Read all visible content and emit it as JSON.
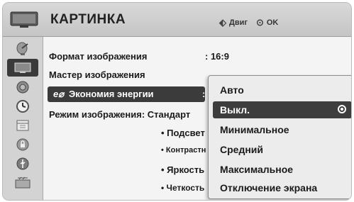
{
  "header": {
    "title": "КАРТИНКА",
    "nav_symbol": "⬖",
    "nav_label": "Двиг",
    "ok_symbol": "⊙",
    "ok_label": "OK"
  },
  "sidebar": {
    "items": [
      {
        "icon": "satellite-dish-icon"
      },
      {
        "icon": "tv-picture-icon",
        "selected": true
      },
      {
        "icon": "speaker-icon"
      },
      {
        "icon": "clock-icon"
      },
      {
        "icon": "calendar-icon"
      },
      {
        "icon": "lock-icon"
      },
      {
        "icon": "usb-icon"
      },
      {
        "icon": "dvr-icon"
      }
    ]
  },
  "menu": {
    "aspect_label": "Формат изображения",
    "aspect_value": ": 16:9",
    "wizard_label": "Мастер изображения",
    "energy_label": "Экономия энергии",
    "energy_colon": ":",
    "mode_label": "Режим изображения: Стандарт",
    "sub_items": [
      "• Подсвет",
      "• Контрастн",
      "• Яркость",
      "• Четкость"
    ]
  },
  "popup": {
    "options": [
      {
        "label": "Авто",
        "selected": false
      },
      {
        "label": "Выкл.",
        "selected": true
      },
      {
        "label": "Минимальное",
        "selected": false
      },
      {
        "label": "Средний",
        "selected": false
      },
      {
        "label": "Максимальное",
        "selected": false
      },
      {
        "label": "Отключение экрана",
        "selected": false
      }
    ]
  },
  "colors": {
    "header_bg": "#cfcfcf",
    "selection_bg": "#3b3b3b",
    "panel_bg": "#f4f4f4"
  }
}
